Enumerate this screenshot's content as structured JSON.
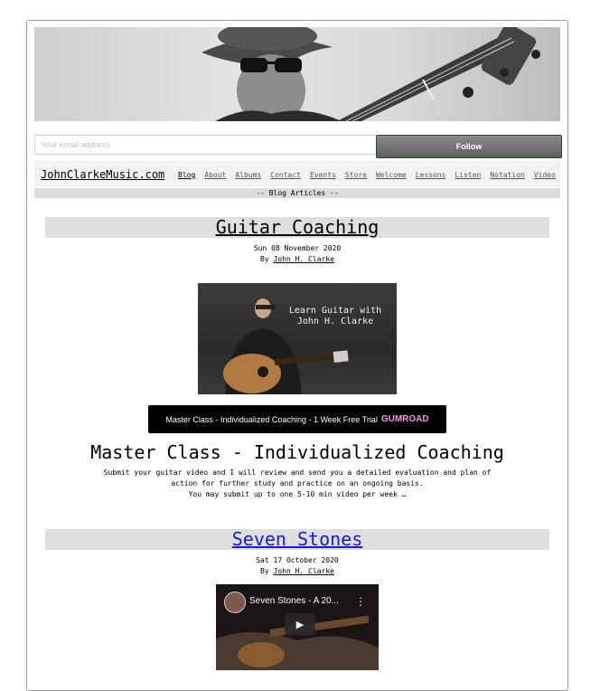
{
  "signup": {
    "email_placeholder": "Your email address",
    "follow_label": "Follow"
  },
  "header": {
    "site_name": "JohnClarkeMusic.com",
    "nav": [
      "Blog",
      "About",
      "Albums",
      "Contact",
      "Events",
      "Store",
      "Welcome",
      "Lessons",
      "Listen",
      "Notation",
      "Video"
    ],
    "section_label": "-- Blog Articles --"
  },
  "posts": [
    {
      "title": "Guitar Coaching",
      "date": "Sun 08 November 2020",
      "by_label": "By",
      "author": "John H. Clarke",
      "image_caption": "Learn Guitar with John H. Clarke",
      "gumroad_label": "Master Class - Individualized Coaching - 1 Week Free Trial",
      "gumroad_brand": "GUMROAD",
      "offer_heading": "Master Class - Individualized Coaching",
      "offer_text": "Submit your guitar video and I will review and send you a detailed evaluation and plan of action for further study and practice on an ongoing basis.",
      "offer_text2": "You may submit up to one 5-10 min video per week …"
    },
    {
      "title": "Seven Stones",
      "date": "Sat 17 October 2020",
      "by_label": "By",
      "author": "John H. Clarke",
      "video_title": "Seven Stones - A 20..."
    }
  ],
  "colors": {
    "link_blue": "#1a1adb",
    "title_bar": "#dfdfdf",
    "gumroad_pink": "#ff90e8"
  }
}
